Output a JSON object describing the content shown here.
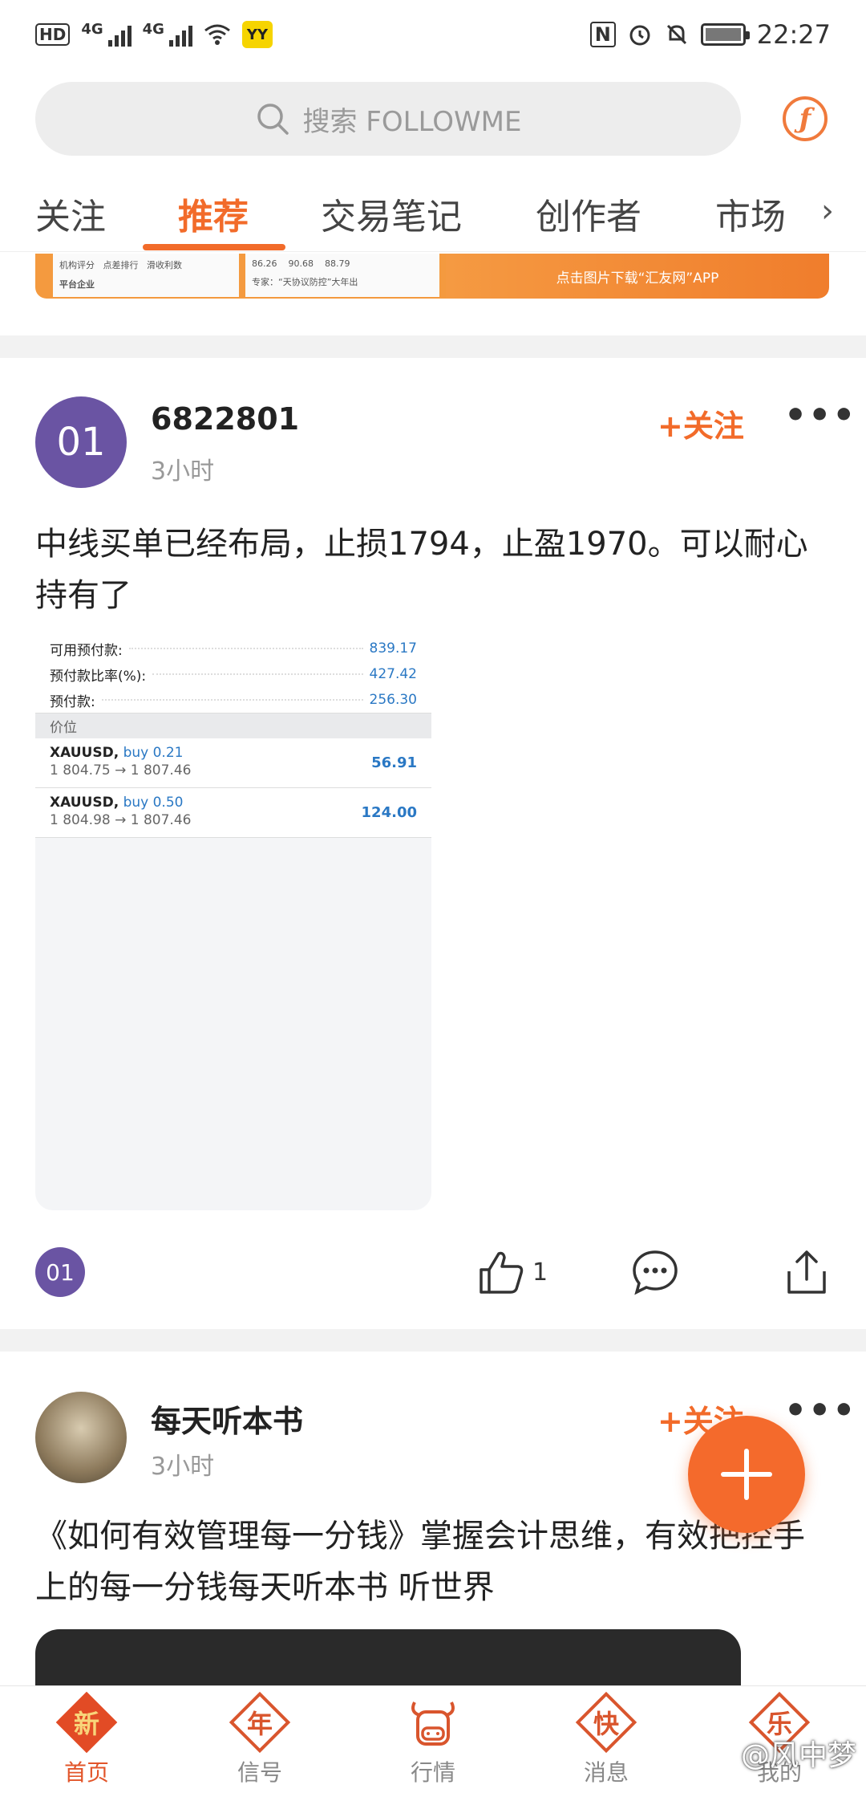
{
  "status_bar": {
    "hd": "HD",
    "sim1_net": "4G",
    "sim2_net": "4G",
    "yy": "YY",
    "nfc": "N",
    "time": "22:27"
  },
  "search": {
    "placeholder": "搜索 FOLLOWME"
  },
  "tabs": [
    {
      "label": "关注",
      "active": false
    },
    {
      "label": "推荐",
      "active": true
    },
    {
      "label": "交易笔记",
      "active": false
    },
    {
      "label": "创作者",
      "active": false
    },
    {
      "label": "市场",
      "active": false
    }
  ],
  "banner": {
    "cells": [
      "机构评分",
      "点差排行",
      "滑收利数",
      "86.26",
      "90.68",
      "88.79"
    ],
    "sub": "平台企业",
    "sub2": "专家：“天协议防控”大年出",
    "cta": "点击图片下载“汇友网”APP"
  },
  "post1": {
    "avatar_text": "01",
    "username": "6822801",
    "time": "3小时",
    "follow_label": "+关注",
    "text": "中线买单已经布局，止损1794，止盈1970。可以耐心持有了",
    "trade": {
      "rows": [
        {
          "label": "可用预付款:",
          "value": "839.17"
        },
        {
          "label": "预付款比率(%):",
          "value": "427.42"
        },
        {
          "label": "预付款:",
          "value": "256.30"
        }
      ],
      "section": "价位",
      "positions": [
        {
          "symbol": "XAUUSD,",
          "dir": " buy 0.21",
          "range": "1 804.75 → 1 807.46",
          "pnl": "56.91"
        },
        {
          "symbol": "XAUUSD,",
          "dir": " buy 0.50",
          "range": "1 804.98 → 1 807.46",
          "pnl": "124.00"
        }
      ]
    },
    "mini_avatar": "01",
    "likes": "1"
  },
  "post2": {
    "username": "每天听本书",
    "time": "3小时",
    "follow_label": "+关注",
    "text": "《如何有效管理每一分钱》掌握会计思维，有效把控手上的每一分钱每天听本书 听世界"
  },
  "bottom_nav": [
    {
      "glyph": "新",
      "label": "首页",
      "active": true
    },
    {
      "glyph": "年",
      "label": "信号",
      "active": false
    },
    {
      "glyph": "",
      "label": "行情",
      "active": false
    },
    {
      "glyph": "快",
      "label": "消息",
      "active": false
    },
    {
      "glyph": "乐",
      "label": "我的",
      "active": false
    }
  ],
  "watermark": "@风中梦",
  "colors": {
    "accent": "#f26b2a",
    "avatar": "#6a54a3",
    "value_blue": "#2a78c4"
  }
}
